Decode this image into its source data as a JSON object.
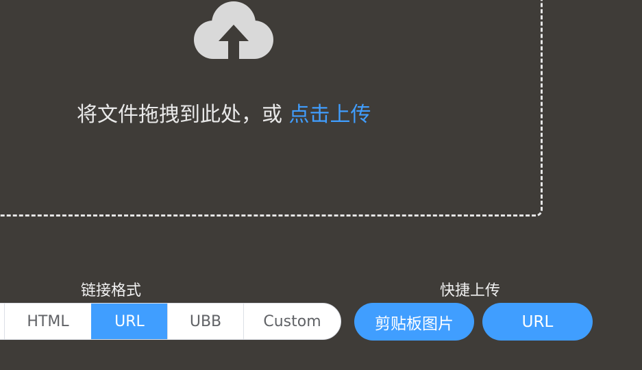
{
  "upload": {
    "prompt": "将文件拖拽到此处，或",
    "link": "点击上传"
  },
  "link_format": {
    "title": "链接格式",
    "options": [
      "",
      "HTML",
      "URL",
      "UBB",
      "Custom"
    ],
    "selected": "URL"
  },
  "quick_upload": {
    "title": "快捷上传",
    "clipboard_label": "剪贴板图片",
    "url_label": "URL"
  },
  "colors": {
    "background": "#3f3c38",
    "accent": "#409eff",
    "dashed_border": "#e6e6e6",
    "icon": "#d9d9d9"
  },
  "icons": {
    "upload": "cloud-upload-icon"
  }
}
